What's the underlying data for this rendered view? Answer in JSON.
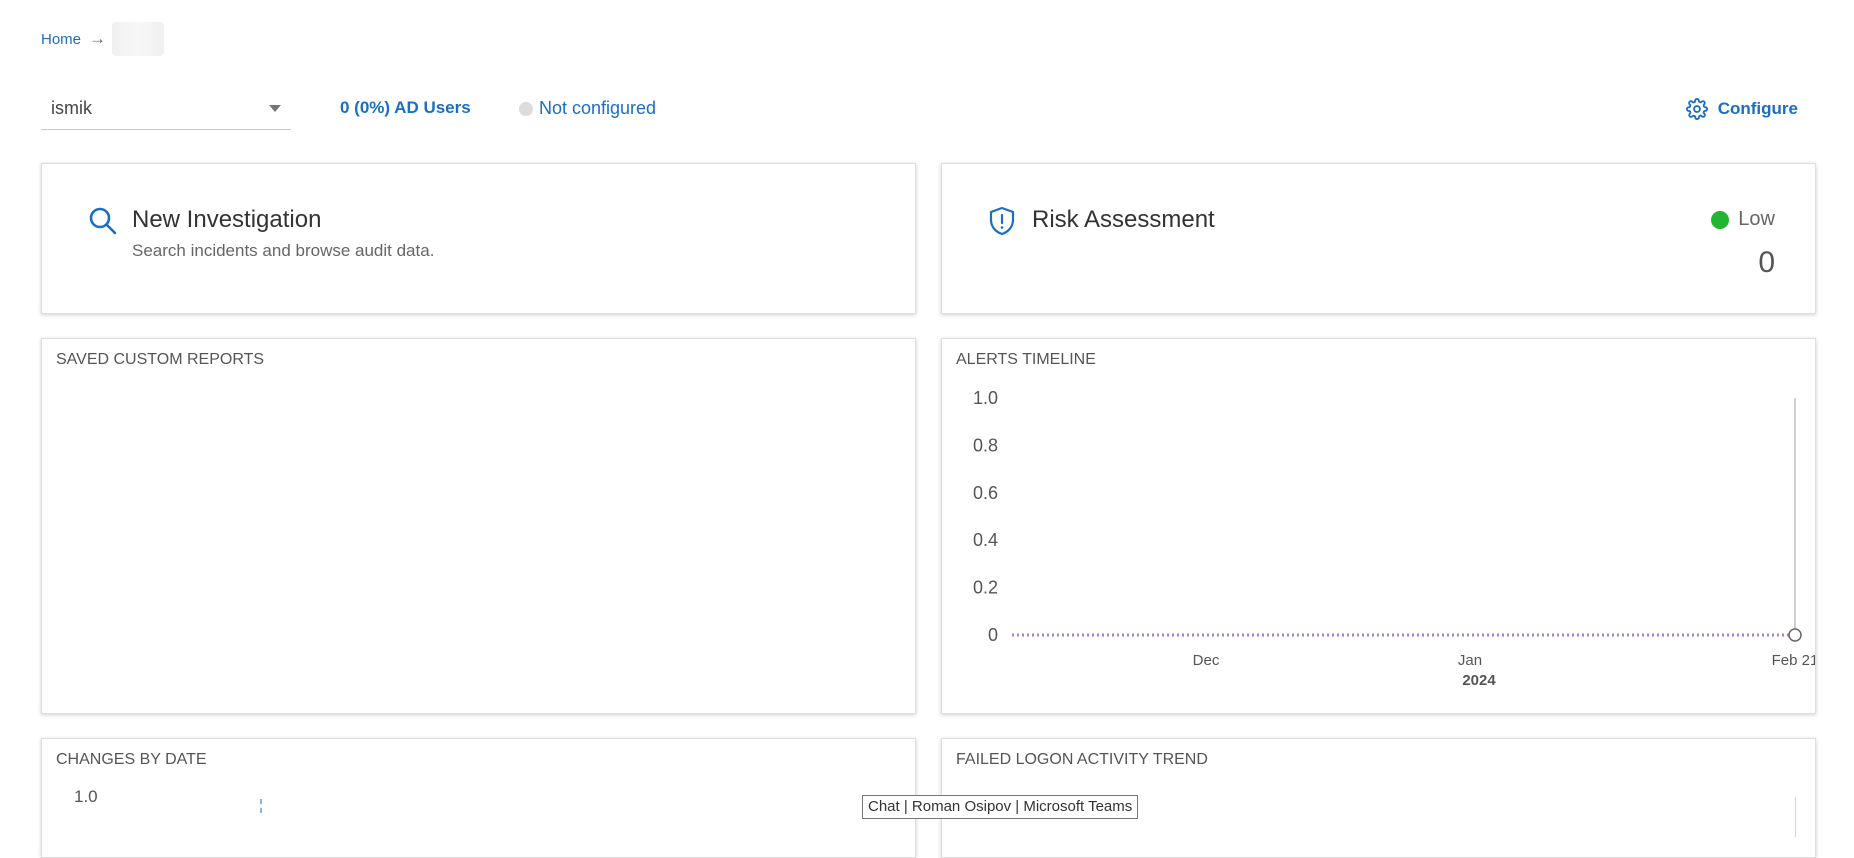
{
  "breadcrumb": {
    "home": "Home",
    "separator": "→"
  },
  "toolbar": {
    "selected_domain": "ismik",
    "ad_users": "0 (0%) AD Users",
    "status": "Not configured",
    "configure": "Configure"
  },
  "investigation": {
    "title": "New Investigation",
    "subtitle": "Search incidents and browse audit data.",
    "icon": "search-icon"
  },
  "risk": {
    "title": "Risk Assessment",
    "level": "Low",
    "score": "0",
    "level_color": "#22b531",
    "icon": "shield-alert-icon"
  },
  "saved_reports": {
    "title": "SAVED CUSTOM REPORTS"
  },
  "alerts_timeline": {
    "title": "ALERTS TIMELINE"
  },
  "changes_by_date": {
    "title": "CHANGES BY DATE",
    "y_first_tick": "1.0"
  },
  "failed_logon": {
    "title": "FAILED LOGON ACTIVITY TREND"
  },
  "tooltip": {
    "text": "Chat | Roman Osipov | Microsoft Teams"
  },
  "colors": {
    "accent": "#1a6fc4",
    "series": "#a97fd3"
  },
  "chart_data": {
    "type": "line",
    "title": "ALERTS TIMELINE",
    "xlabel": "",
    "ylabel": "",
    "ylim": [
      0,
      1.0
    ],
    "y_ticks": [
      "1.0",
      "0.8",
      "0.6",
      "0.4",
      "0.2",
      "0"
    ],
    "x_ticks": [
      "Dec",
      "Jan",
      "Feb 21"
    ],
    "x_sub_label": "2024",
    "series": [
      {
        "values": [
          0,
          0,
          0,
          0,
          0,
          0,
          0,
          0,
          0,
          0,
          0,
          0,
          0,
          0,
          0,
          0,
          0,
          0,
          0,
          0,
          0,
          0,
          0,
          0,
          0,
          0,
          0,
          0,
          0,
          0,
          0,
          0,
          0,
          0,
          0,
          0,
          0,
          0,
          0,
          0,
          0,
          0,
          0,
          0,
          0,
          0,
          0,
          0,
          0,
          0,
          0,
          0,
          0,
          0,
          0,
          0,
          0,
          0,
          0,
          0,
          0,
          0,
          0,
          0,
          0,
          0,
          0,
          0,
          0,
          0,
          0,
          0,
          0,
          0,
          0,
          0,
          0,
          0,
          0,
          0,
          0,
          0,
          0,
          0,
          0,
          0,
          0,
          0,
          0,
          0,
          0,
          0,
          0,
          0,
          0,
          0,
          0,
          0,
          0,
          0,
          0,
          0,
          0,
          0,
          0,
          0,
          0,
          0,
          0,
          0,
          0,
          0,
          0,
          0,
          0
        ]
      }
    ],
    "grid": false,
    "legend": "none"
  }
}
